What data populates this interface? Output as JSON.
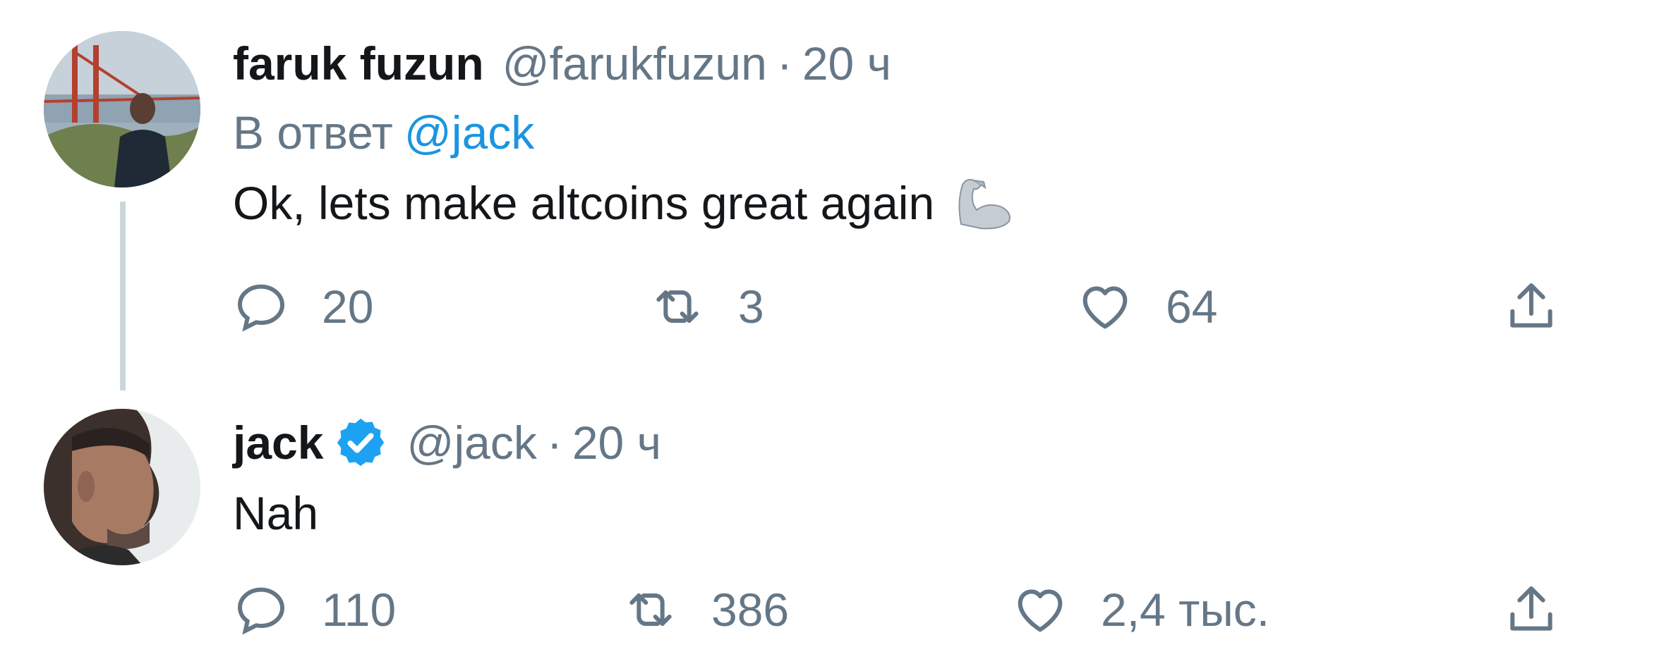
{
  "tweets": [
    {
      "name": "faruk fuzun",
      "handle": "@farukfuzun",
      "separator": "·",
      "time": "20 ч",
      "reply_prefix": "В ответ",
      "reply_mention": "@jack",
      "text": "Ok, lets make altcoins great again",
      "emoji": "flexed-biceps-emoji",
      "replies": "20",
      "retweets": "3",
      "likes": "64"
    },
    {
      "name": "jack",
      "verified": true,
      "handle": "@jack",
      "separator": "·",
      "time": "20 ч",
      "text": "Nah",
      "replies": "110",
      "retweets": "386",
      "likes": "2,4 тыс."
    }
  ],
  "colors": {
    "text_primary": "#14171a",
    "text_secondary": "#657786",
    "link": "#1b95e0",
    "thread_line": "#ccd6dd"
  }
}
